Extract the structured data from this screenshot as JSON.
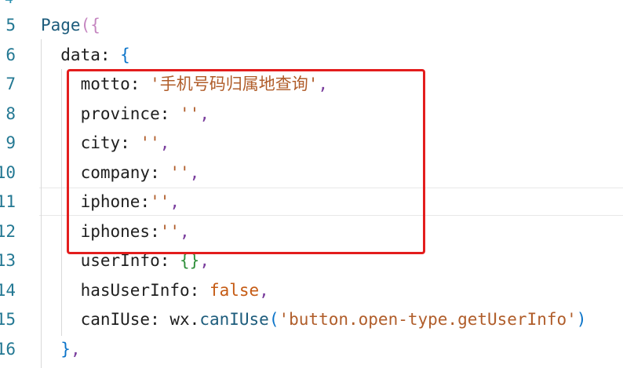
{
  "editor": {
    "top_partial_line": "4",
    "lines": [
      {
        "num": "5",
        "tokens": [
          {
            "t": "Page",
            "c": "fn"
          },
          {
            "t": "(",
            "c": "b1"
          },
          {
            "t": "{",
            "c": "b1"
          }
        ]
      },
      {
        "num": "6",
        "tokens": [
          {
            "t": "  data",
            "c": "k"
          },
          {
            "t": ": ",
            "c": "k"
          },
          {
            "t": "{",
            "c": "b3"
          }
        ]
      },
      {
        "num": "7",
        "tokens": [
          {
            "t": "    motto",
            "c": "k"
          },
          {
            "t": ": ",
            "c": "k"
          },
          {
            "t": "'手机号码归属地查询'",
            "c": "s"
          },
          {
            "t": ",",
            "c": "p"
          }
        ]
      },
      {
        "num": "8",
        "tokens": [
          {
            "t": "    province",
            "c": "k"
          },
          {
            "t": ": ",
            "c": "k"
          },
          {
            "t": "''",
            "c": "s"
          },
          {
            "t": ",",
            "c": "p"
          }
        ]
      },
      {
        "num": "9",
        "tokens": [
          {
            "t": "    city",
            "c": "k"
          },
          {
            "t": ": ",
            "c": "k"
          },
          {
            "t": "''",
            "c": "s"
          },
          {
            "t": ",",
            "c": "p"
          }
        ]
      },
      {
        "num": "10",
        "tokens": [
          {
            "t": "    company",
            "c": "k"
          },
          {
            "t": ": ",
            "c": "k"
          },
          {
            "t": "''",
            "c": "s"
          },
          {
            "t": ",",
            "c": "p"
          }
        ]
      },
      {
        "num": "11",
        "tokens": [
          {
            "t": "    iphone",
            "c": "k"
          },
          {
            "t": ":",
            "c": "k"
          },
          {
            "t": "''",
            "c": "s"
          },
          {
            "t": ",",
            "c": "p"
          }
        ]
      },
      {
        "num": "12",
        "tokens": [
          {
            "t": "    iphones",
            "c": "k"
          },
          {
            "t": ":",
            "c": "k"
          },
          {
            "t": "''",
            "c": "s"
          },
          {
            "t": ",",
            "c": "p"
          }
        ]
      },
      {
        "num": "13",
        "tokens": [
          {
            "t": "    userInfo",
            "c": "k"
          },
          {
            "t": ": ",
            "c": "k"
          },
          {
            "t": "{}",
            "c": "b2"
          },
          {
            "t": ",",
            "c": "p"
          }
        ]
      },
      {
        "num": "14",
        "tokens": [
          {
            "t": "    hasUserInfo",
            "c": "k"
          },
          {
            "t": ": ",
            "c": "k"
          },
          {
            "t": "false",
            "c": "kw"
          },
          {
            "t": ",",
            "c": "p"
          }
        ]
      },
      {
        "num": "15",
        "tokens": [
          {
            "t": "    canIUse",
            "c": "k"
          },
          {
            "t": ": ",
            "c": "k"
          },
          {
            "t": "wx",
            "c": "obj"
          },
          {
            "t": ".",
            "c": "k"
          },
          {
            "t": "canIUse",
            "c": "m"
          },
          {
            "t": "(",
            "c": "b3"
          },
          {
            "t": "'button.open-type.getUserInfo'",
            "c": "s"
          },
          {
            "t": ")",
            "c": "b3"
          }
        ]
      },
      {
        "num": "16",
        "tokens": [
          {
            "t": "  }",
            "c": "b3"
          },
          {
            "t": ",",
            "c": "p"
          }
        ]
      }
    ]
  },
  "colors": {
    "highlight_box": "#e31d1d",
    "line_number": "#237893",
    "string": "#b05d2a",
    "keyword": "#c55b14"
  }
}
